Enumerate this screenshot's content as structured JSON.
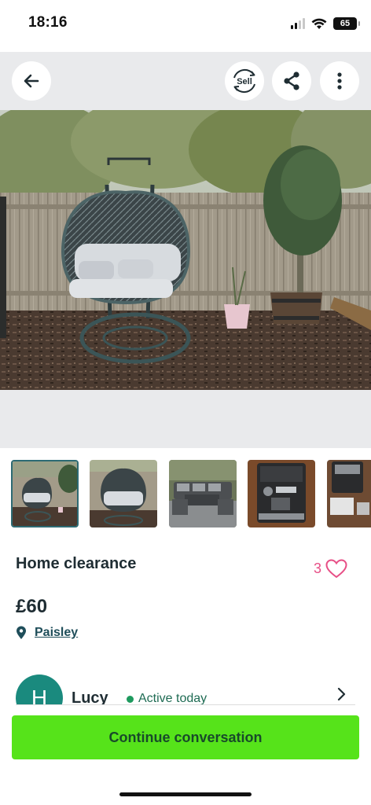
{
  "status_bar": {
    "time": "18:16",
    "battery": "65"
  },
  "header": {
    "back_icon": "arrow-left-icon",
    "sell_label": "Sell",
    "share_icon": "share-icon",
    "more_icon": "more-vertical-icon"
  },
  "gallery": {
    "thumbnail_count": 5,
    "selected_index": 0,
    "thumbnails": [
      "hanging egg chair",
      "hanging egg chair",
      "rattan garden sofa set",
      "coffee machine",
      "coffee machine"
    ]
  },
  "listing": {
    "title": "Home clearance",
    "favourite_count": "3",
    "price": "£60",
    "location": "Paisley"
  },
  "seller": {
    "initial": "H",
    "name": "Lucy",
    "status": "Active today"
  },
  "cta": {
    "label": "Continue conversation"
  },
  "colors": {
    "accent_green": "#56e31a",
    "heart_pink": "#e74f86",
    "avatar_teal": "#1a8a7e",
    "header_grey": "#e9eaec"
  }
}
